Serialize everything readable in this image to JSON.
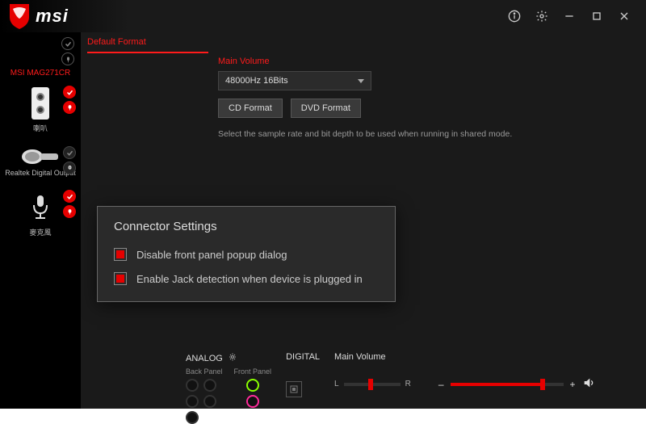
{
  "brand": "msi",
  "titlebar_icons": {
    "info": "Info",
    "settings": "Settings",
    "min": "Minimize",
    "max": "Maximize",
    "close": "Close"
  },
  "sidebar": {
    "monitor_label": "MSI MAG271CR",
    "devices": [
      {
        "label": "喇叭",
        "kind": "speakers"
      },
      {
        "label": "Realtek Digital Output",
        "kind": "optical"
      },
      {
        "label": "麥克風",
        "kind": "mic"
      }
    ]
  },
  "tabs": {
    "active": "Default Format"
  },
  "section_title": "Main Volume",
  "sample_rate_select": "48000Hz 16Bits",
  "buttons": {
    "cd": "CD Format",
    "dvd": "DVD Format"
  },
  "hint": "Select the sample rate and bit depth to be used when running in shared mode.",
  "popup": {
    "title": "Connector Settings",
    "opt1": "Disable front panel popup dialog",
    "opt2": "Enable Jack detection when device is plugged in"
  },
  "bottombar": {
    "analog_label": "ANALOG",
    "back_label": "Back Panel",
    "front_label": "Front Panel",
    "digital_label": "DIGITAL",
    "volume_label": "Main Volume",
    "balance_L": "L",
    "balance_R": "R",
    "balance_pos_pct": 47,
    "volume_pct": 82,
    "minus": "–",
    "plus": "+"
  }
}
